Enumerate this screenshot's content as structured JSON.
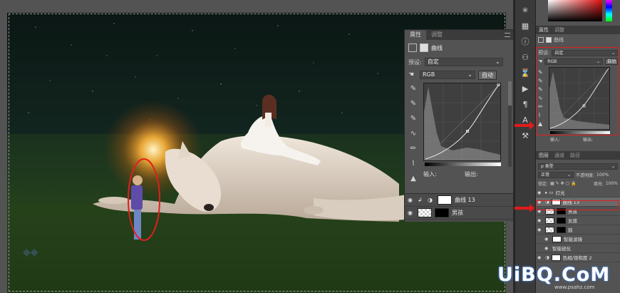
{
  "canvas": {
    "description_icon": "photo-canvas"
  },
  "properties_panel": {
    "tab_properties": "属性",
    "tab_adjust": "调整",
    "layer_type": "曲线",
    "preset_label": "预设:",
    "preset_value": "自定",
    "channel_value": "RGB",
    "auto_button": "自动",
    "input_label": "输入:",
    "output_label": "输出:"
  },
  "inline_layers": [
    {
      "name": "曲线 13"
    },
    {
      "name": "男孩"
    }
  ],
  "right_panel": {
    "tab_properties": "属性",
    "tab_adjust": "调整",
    "layer_type": "曲线",
    "preset_label": "预设:",
    "preset_value": "自定",
    "channel_value": "RGB",
    "auto_button": "自动",
    "input_label": "输入:",
    "output_label": "输出:",
    "layers_tab": "图层",
    "channels_tab": "通道",
    "paths_tab": "路径",
    "filter_kind": "ρ 类型",
    "blend_mode": "正常",
    "opacity_label": "不透明度:",
    "opacity_value": "100%",
    "lock_label": "锁定:",
    "fill_label": "填充:",
    "fill_value": "100%"
  },
  "layers": [
    {
      "name": "灯光"
    },
    {
      "name": "曲线 13"
    },
    {
      "name": "男孩"
    },
    {
      "name": "女孩"
    },
    {
      "name": "狼"
    },
    {
      "name": "智能滤镜"
    },
    {
      "name": "智能锐化"
    },
    {
      "name": "色相/饱和度 2"
    }
  ],
  "brand": {
    "logo_text": "UiBQ.CoM",
    "sub_text": "www.psahz.com"
  },
  "colors": {
    "accent_red": "#e21b1b",
    "panel_bg": "#535353"
  }
}
